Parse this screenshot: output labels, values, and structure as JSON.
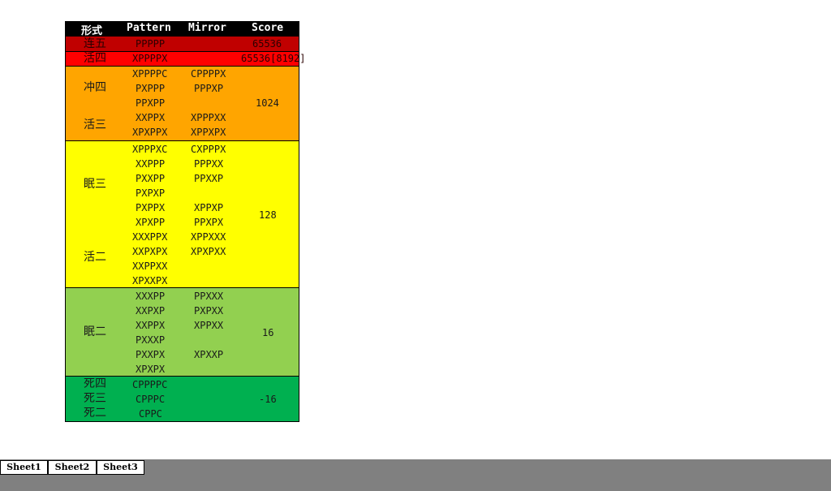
{
  "headers": {
    "shape": "形式",
    "pattern": "Pattern",
    "mirror": "Mirror",
    "score": "Score"
  },
  "bands": {
    "lianwu": {
      "shapes": [
        "连五"
      ],
      "patterns": [
        "PPPPP"
      ],
      "mirrors": [],
      "score": "65536",
      "color": "#c00000"
    },
    "huosi": {
      "shapes": [
        "活四"
      ],
      "patterns": [
        "XPPPPX"
      ],
      "mirrors": [],
      "score": "65536[8192]",
      "color": "#ff0000"
    },
    "chongsi_huosan": {
      "shapes": [
        "冲四",
        "活三"
      ],
      "patterns": [
        "XPPPPC",
        "PXPPP",
        "PPXPP",
        "XXPPX",
        "XPXPPX"
      ],
      "mirrors": [
        "CPPPPX",
        "PPPXP",
        "XPPPXX",
        "XPPXPX"
      ],
      "score": "1024",
      "color": "#ffa500"
    },
    "miansan_huoer": {
      "shapes": [
        "眠三",
        "活二"
      ],
      "patterns": [
        "XPPPXC",
        "XXPPP",
        "PXXPP",
        "PXPXP",
        "PXPPX",
        "XPXPP",
        "XXXPPX",
        "XXPXPX",
        "XXPPXX",
        "XPXXPX"
      ],
      "mirrors": [
        "CXPPPX",
        "PPPXX",
        "PPXXP",
        "XPPXP",
        "PPXPX",
        "XPPXXX",
        "XPXPXX"
      ],
      "score": "128",
      "color": "#ffff00"
    },
    "mianer": {
      "shapes": [
        "眠二"
      ],
      "patterns": [
        "XXXPP",
        "XXPXP",
        "XXPPX",
        "PXXXP",
        "PXXPX",
        "XPXPX"
      ],
      "mirrors": [
        "PPXXX",
        "PXPXX",
        "XPPXX",
        "XPXXP"
      ],
      "score": "16",
      "color": "#92d050"
    },
    "dead": {
      "shapes": [
        "死四",
        "死三",
        "死二"
      ],
      "patterns": [
        "CPPPPC",
        "CPPPC",
        "CPPC"
      ],
      "mirrors": [],
      "score": "-16",
      "color": "#00b050"
    }
  },
  "tabs": [
    "Sheet1",
    "Sheet2",
    "Sheet3"
  ],
  "colors": {
    "header_bg": "#000000",
    "tab_bar": "#808080"
  }
}
